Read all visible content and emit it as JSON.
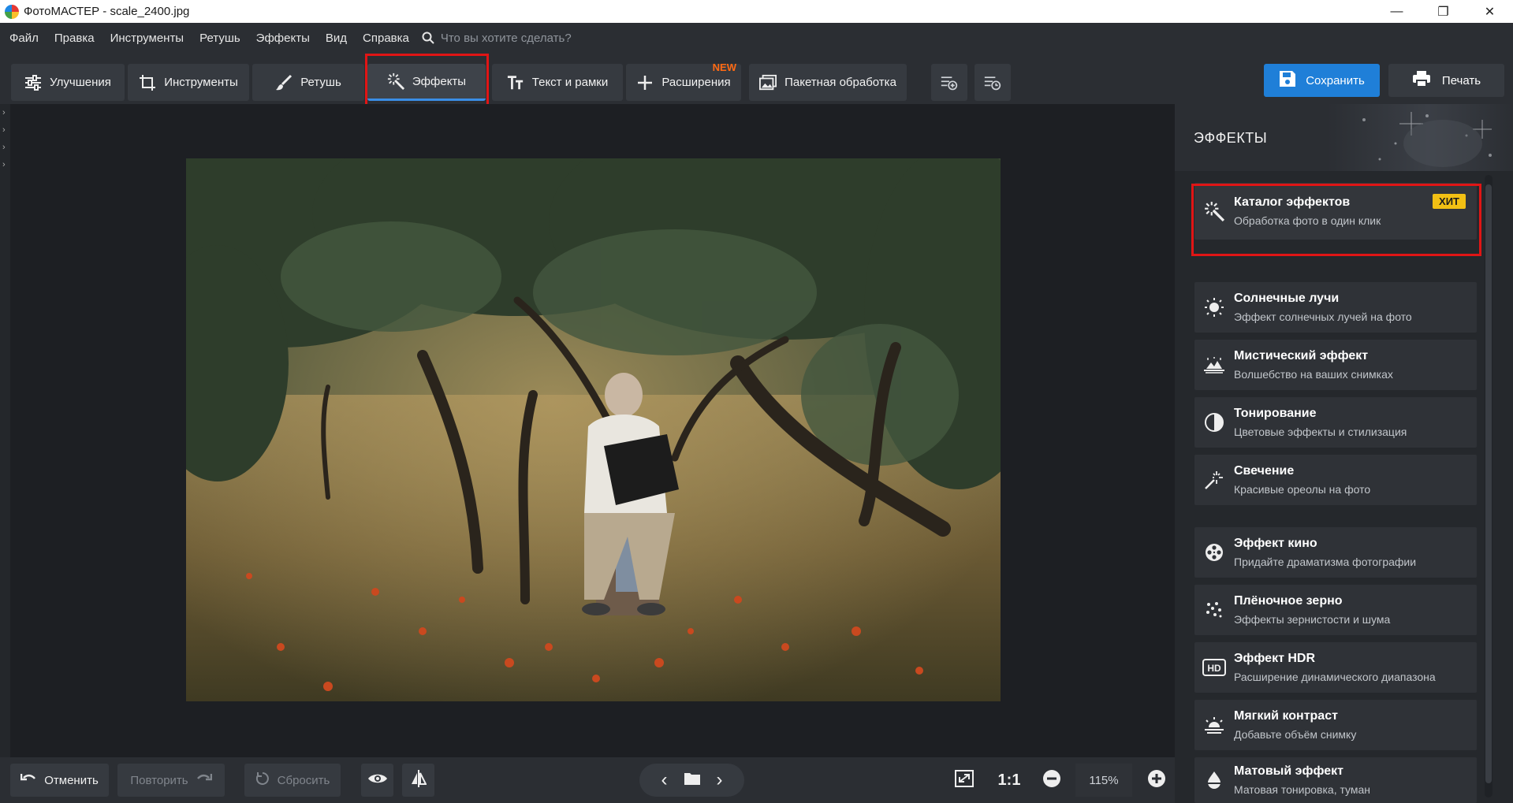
{
  "window": {
    "title": "ФотоМАСТЕР - scale_2400.jpg",
    "controls": [
      "minimize-icon",
      "restore-icon",
      "close-icon"
    ]
  },
  "menu": {
    "items": [
      "Файл",
      "Правка",
      "Инструменты",
      "Ретушь",
      "Эффекты",
      "Вид",
      "Справка"
    ],
    "search_placeholder": "Что вы хотите сделать?"
  },
  "toolbar": {
    "tabs": [
      {
        "label": "Улучшения",
        "icon": "sliders-icon"
      },
      {
        "label": "Инструменты",
        "icon": "crop-icon"
      },
      {
        "label": "Ретушь",
        "icon": "brush-icon"
      },
      {
        "label": "Эффекты",
        "icon": "magic-wand-icon",
        "active": true
      },
      {
        "label": "Текст и рамки",
        "icon": "text-icon"
      },
      {
        "label": "Расширения",
        "icon": "plus-icon",
        "badge": "NEW"
      },
      {
        "label": "Пакетная обработка",
        "icon": "images-icon"
      }
    ],
    "save_label": "Сохранить",
    "print_label": "Печать"
  },
  "bottom": {
    "undo_label": "Отменить",
    "redo_label": "Повторить",
    "reset_label": "Сбросить",
    "one_to_one": "1:1",
    "zoom": "115%"
  },
  "panel": {
    "title": "ЭФФЕКТЫ",
    "catalog": {
      "title": "Каталог эффектов",
      "subtitle": "Обработка фото в один клик",
      "badge": "ХИТ"
    },
    "effects": [
      {
        "title": "Солнечные лучи",
        "subtitle": "Эффект солнечных лучей на фото",
        "icon": "sun-icon"
      },
      {
        "title": "Мистический эффект",
        "subtitle": "Волшебство на ваших снимках",
        "icon": "mystic-icon"
      },
      {
        "title": "Тонирование",
        "subtitle": "Цветовые эффекты и стилизация",
        "icon": "contrast-circle-icon"
      },
      {
        "title": "Свечение",
        "subtitle": "Красивые ореолы на фото",
        "icon": "sparkle-wand-icon"
      },
      {
        "title": "Эффект кино",
        "subtitle": "Придайте драматизма фотографии",
        "icon": "film-reel-icon"
      },
      {
        "title": "Плёночное зерно",
        "subtitle": "Эффекты зернистости и шума",
        "icon": "grain-icon"
      },
      {
        "title": "Эффект HDR",
        "subtitle": "Расширение динамического диапазона",
        "icon": "hd-icon"
      },
      {
        "title": "Мягкий контраст",
        "subtitle": "Добавьте объём снимку",
        "icon": "sunrise-icon"
      },
      {
        "title": "Матовый эффект",
        "subtitle": "Матовая тонировка, туман",
        "icon": "drop-icon"
      }
    ]
  },
  "colors": {
    "accent": "#1f7fd8",
    "highlight": "#e01515",
    "new_badge": "#ff6a13",
    "hit_badge": "#f2c014",
    "background": "#1b1d21",
    "panel": "#25282c"
  }
}
